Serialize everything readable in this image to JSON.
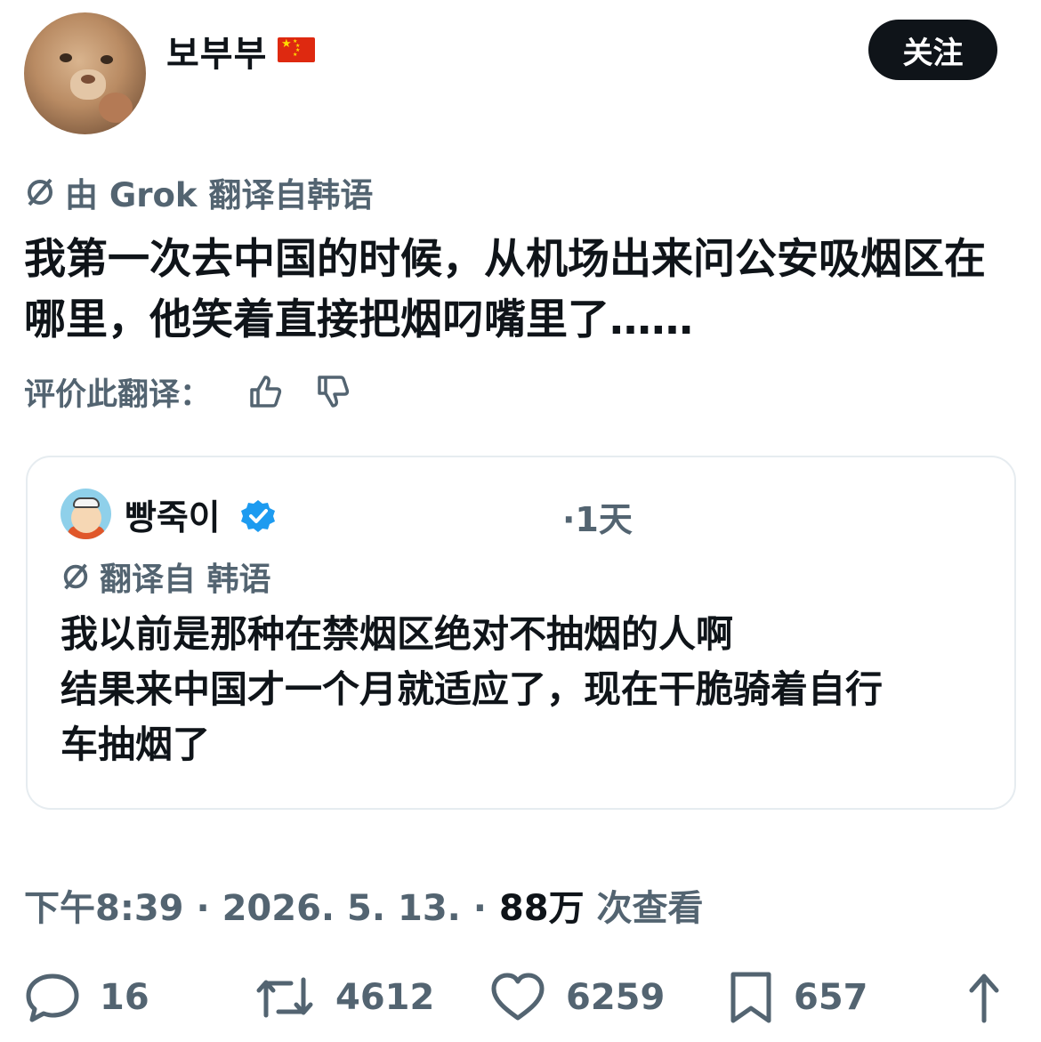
{
  "header": {
    "username": "보부부",
    "flag_icon": "china-flag-icon",
    "follow_label": "关注"
  },
  "translation": {
    "label": "由 Grok 翻译自韩语",
    "icon": "translate-icon"
  },
  "post": {
    "text": "我第一次去中国的时候，从机场出来问公安吸烟区在哪里，他笑着直接把烟叼嘴里了……"
  },
  "rating": {
    "label": "评价此翻译："
  },
  "quote": {
    "username": "빵죽이",
    "verified": true,
    "time": "·1天",
    "translation_label": "翻译自 韩语",
    "text_lines": [
      "我以前是那种在禁烟区绝对不抽烟的人啊",
      "结果来中国才一个月就适应了，现在干脆骑着自行",
      "车抽烟了"
    ]
  },
  "meta": {
    "time": "下午8:39",
    "date": "2026. 5. 13.",
    "views_count": "88万",
    "views_label": "次查看"
  },
  "actions": {
    "replies": "16",
    "reposts": "4612",
    "likes": "6259",
    "bookmarks": "657"
  },
  "colors": {
    "text": "#0f1419",
    "secondary": "#536471",
    "verified": "#1d9bf0",
    "follow_bg": "#0f1419"
  }
}
